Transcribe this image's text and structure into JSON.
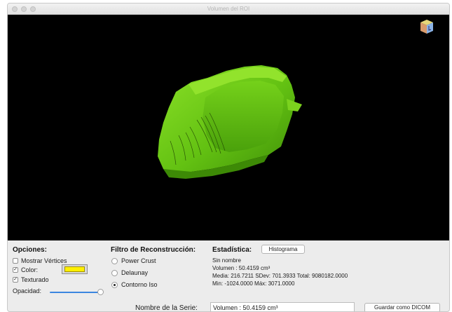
{
  "window": {
    "title": "Volumen del ROI"
  },
  "options": {
    "title": "Opciones:",
    "show_vertices_label": "Mostrar Vértices",
    "show_vertices_checked": false,
    "color_label": "Color:",
    "color_checked": true,
    "color_value": "#fff000",
    "textured_label": "Texturado",
    "textured_checked": true,
    "opacity_label": "Opacidad:",
    "opacity_level": 1.0
  },
  "filter": {
    "title": "Filtro de Reconstrucción:",
    "options": [
      "Power Crust",
      "Delaunay",
      "Contorno Iso"
    ],
    "selected": "Contorno Iso"
  },
  "stats": {
    "title": "Estadística:",
    "histogram_button": "Histograma",
    "name": "Sin nombre",
    "volume": "Volumen : 50.4159 cm³",
    "mean_line": "Media: 216.7211 SDev: 701.3933 Total: 9080182.0000",
    "minmax_line": "Min: -1024.0000 Máx: 3071.0000"
  },
  "series": {
    "label": "Nombre de la Serie:",
    "value": "Volumen : 50.4159 cm³",
    "save_button": "Guardar como DICOM"
  },
  "viewport": {
    "background": "#000000",
    "mesh_color": "#6ccc12"
  },
  "icons": {
    "orientation_cube": "orientation-cube-icon"
  }
}
